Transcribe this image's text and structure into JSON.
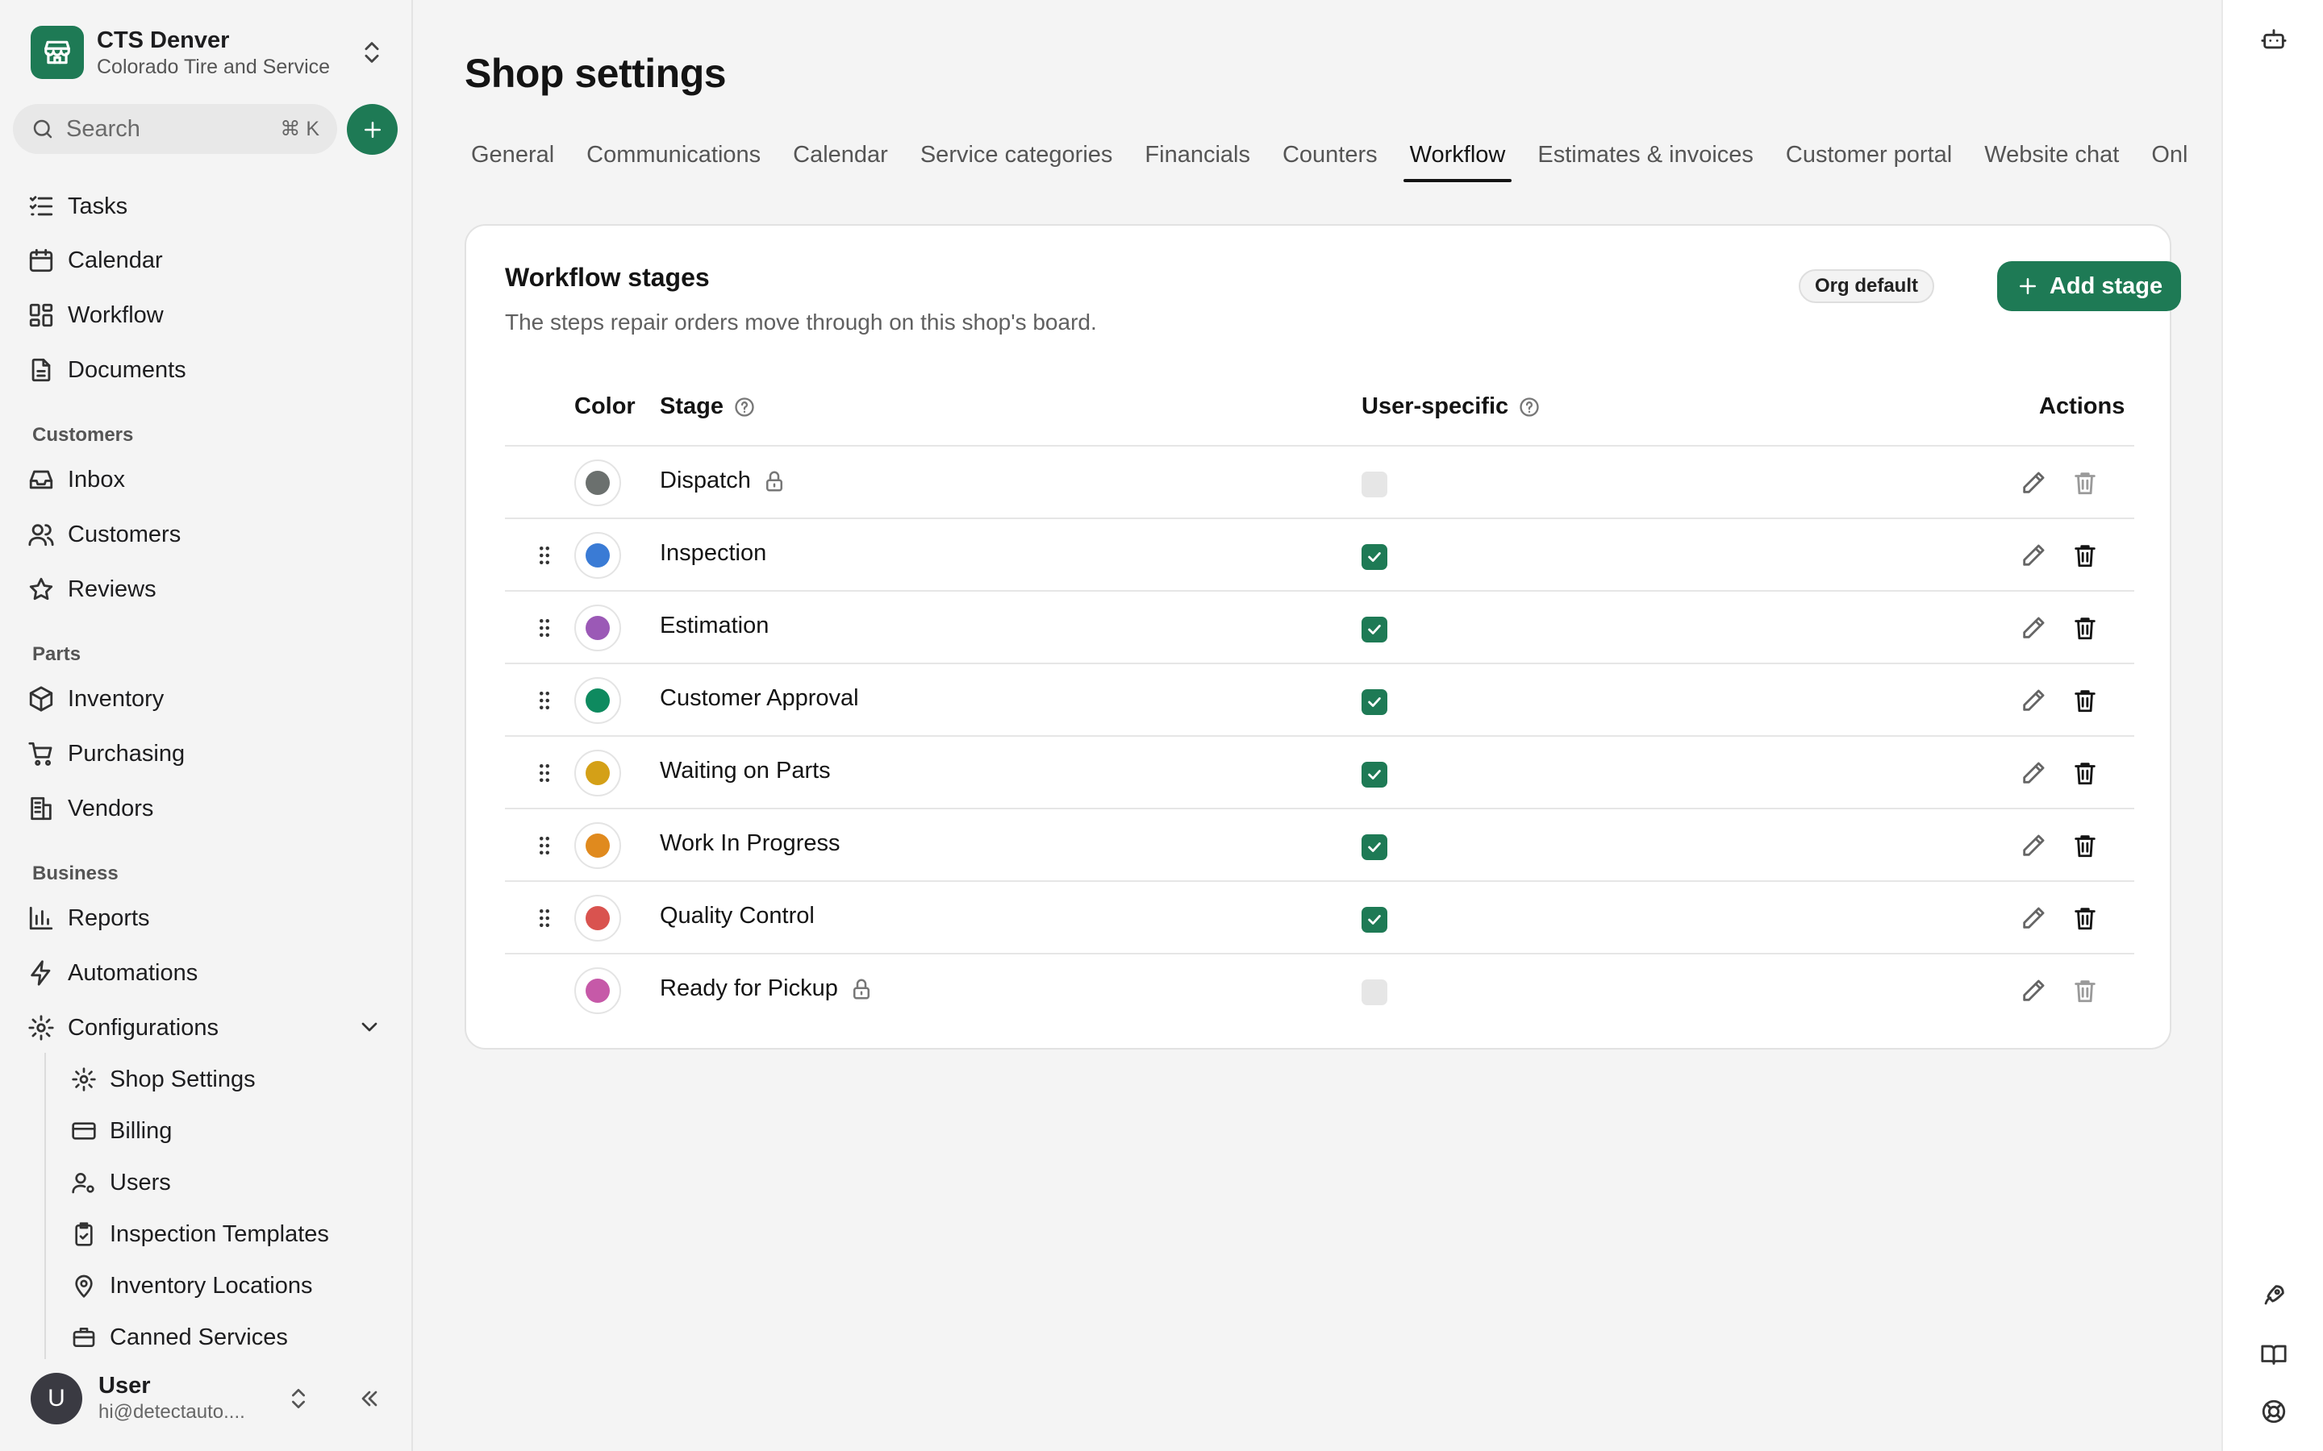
{
  "shop": {
    "name": "CTS Denver",
    "org": "Colorado Tire and Service"
  },
  "search": {
    "placeholder": "Search",
    "shortcut": "⌘ K"
  },
  "nav": {
    "main": [
      {
        "label": "Tasks",
        "icon": "tasks-icon"
      },
      {
        "label": "Calendar",
        "icon": "calendar-icon"
      },
      {
        "label": "Workflow",
        "icon": "workflow-icon"
      },
      {
        "label": "Documents",
        "icon": "document-icon"
      }
    ],
    "sections": {
      "customers": "Customers",
      "parts": "Parts",
      "business": "Business"
    },
    "customers": [
      {
        "label": "Inbox",
        "icon": "inbox-icon"
      },
      {
        "label": "Customers",
        "icon": "users-icon"
      },
      {
        "label": "Reviews",
        "icon": "star-icon"
      }
    ],
    "parts": [
      {
        "label": "Inventory",
        "icon": "box-icon"
      },
      {
        "label": "Purchasing",
        "icon": "cart-icon"
      },
      {
        "label": "Vendors",
        "icon": "building-icon"
      }
    ],
    "business": [
      {
        "label": "Reports",
        "icon": "bar-chart-icon"
      },
      {
        "label": "Automations",
        "icon": "lightning-icon"
      },
      {
        "label": "Configurations",
        "icon": "gear-icon"
      }
    ],
    "config_sub": [
      {
        "label": "Shop Settings",
        "icon": "gear-icon"
      },
      {
        "label": "Billing",
        "icon": "credit-card-icon"
      },
      {
        "label": "Users",
        "icon": "user-cog-icon"
      },
      {
        "label": "Inspection Templates",
        "icon": "clipboard-icon"
      },
      {
        "label": "Inventory Locations",
        "icon": "map-pin-icon"
      },
      {
        "label": "Canned Services",
        "icon": "briefcase-icon"
      }
    ]
  },
  "user": {
    "initial": "U",
    "name": "User",
    "email": "hi@detectauto...."
  },
  "page": {
    "title": "Shop settings",
    "tabs": [
      "General",
      "Communications",
      "Calendar",
      "Service categories",
      "Financials",
      "Counters",
      "Workflow",
      "Estimates & invoices",
      "Customer portal",
      "Website chat",
      "Onl"
    ],
    "active_tab": "Workflow"
  },
  "card": {
    "title": "Workflow stages",
    "subtitle": "The steps repair orders move through on this shop's board.",
    "badge": "Org default",
    "add_label": "Add stage",
    "columns": {
      "color": "Color",
      "stage": "Stage",
      "user_specific": "User-specific",
      "actions": "Actions"
    },
    "stages": [
      {
        "name": "Dispatch",
        "color": "#6b706e",
        "user_specific": false,
        "locked": true
      },
      {
        "name": "Inspection",
        "color": "#3a7bd5",
        "user_specific": true,
        "locked": false
      },
      {
        "name": "Estimation",
        "color": "#9b59b6",
        "user_specific": true,
        "locked": false
      },
      {
        "name": "Customer Approval",
        "color": "#0e8a5f",
        "user_specific": true,
        "locked": false
      },
      {
        "name": "Waiting on Parts",
        "color": "#d4a017",
        "user_specific": true,
        "locked": false
      },
      {
        "name": "Work In Progress",
        "color": "#e08a1e",
        "user_specific": true,
        "locked": false
      },
      {
        "name": "Quality Control",
        "color": "#d9534f",
        "user_specific": true,
        "locked": false
      },
      {
        "name": "Ready for Pickup",
        "color": "#c659a8",
        "user_specific": false,
        "locked": true
      }
    ]
  },
  "colors": {
    "brand": "#1e7a55"
  }
}
